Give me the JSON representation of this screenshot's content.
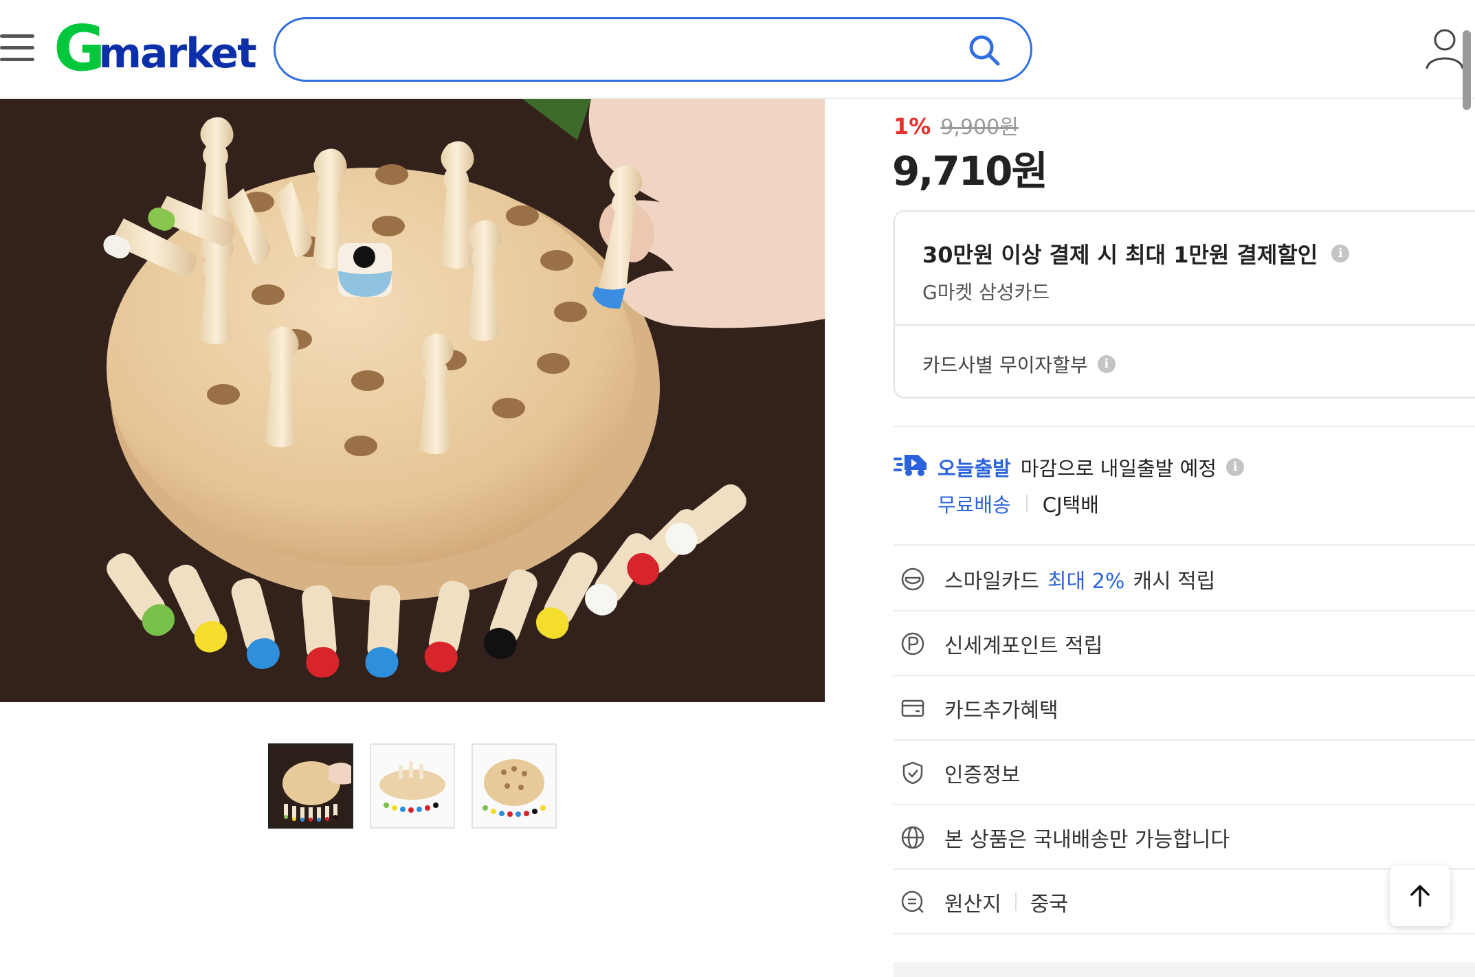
{
  "header": {
    "logo_g": "G",
    "logo_text": "market",
    "search_placeholder": ""
  },
  "product": {
    "image_alt": "원목 기억력 게임 보드",
    "thumbnail_count": 3
  },
  "price": {
    "discount": "1%",
    "original": "9,900원",
    "final": "9,710원"
  },
  "card_offer": {
    "title": "30만원 이상 결제 시 최대 1만원 결제할인",
    "subtitle": "G마켓 삼성카드",
    "installment": "카드사별 무이자할부"
  },
  "shipping": {
    "badge": "오늘출발",
    "text": "마감으로 내일출발 예정",
    "free": "무료배송",
    "carrier": "CJ택배"
  },
  "benefits": {
    "smile_prefix": "스마일카드",
    "smile_highlight": "최대 2%",
    "smile_suffix": "캐시 적립",
    "point": "신세계포인트 적립",
    "card_extra": "카드추가혜택",
    "cert": "인증정보",
    "domestic": "본 상품은 국내배송만 가능합니다",
    "origin_label": "원산지",
    "origin_value": "중국"
  },
  "colors": {
    "brand_green": "#00c73c",
    "brand_blue": "#0a2fa8",
    "accent_blue": "#2a63dc",
    "discount_red": "#e8302d"
  }
}
